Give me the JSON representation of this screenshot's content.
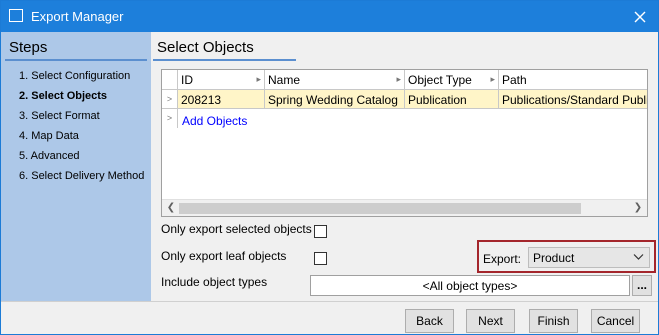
{
  "window": {
    "title": "Export Manager"
  },
  "steps": {
    "title": "Steps",
    "items": [
      {
        "label": "1. Select Configuration",
        "active": false
      },
      {
        "label": "2. Select Objects",
        "active": true
      },
      {
        "label": "3. Select Format",
        "active": false
      },
      {
        "label": "4. Map Data",
        "active": false
      },
      {
        "label": "5. Advanced",
        "active": false
      },
      {
        "label": "6. Select Delivery Method",
        "active": false
      }
    ]
  },
  "main": {
    "title": "Select Objects",
    "table": {
      "columns": [
        "ID",
        "Name",
        "Object Type",
        "Path"
      ],
      "rows": [
        [
          "208213",
          "Spring Wedding Catalog",
          "Publication",
          "Publications/Standard Public..."
        ]
      ],
      "add_link": "Add Objects"
    },
    "options": {
      "only_selected": "Only export selected objects",
      "only_leaf": "Only export leaf objects",
      "include_types": "Include object types",
      "include_types_value": "<All object types>",
      "browse_button": "..."
    },
    "export": {
      "label": "Export:",
      "value": "Product"
    }
  },
  "footer": {
    "back": "Back",
    "next": "Next",
    "finish": "Finish",
    "cancel": "Cancel"
  },
  "colors": {
    "titlebar": "#1d7fdb",
    "steps_panel": "#adc8e8",
    "selected_row": "#fff5c8",
    "highlight_border": "#a4262c",
    "link": "#0000ff"
  }
}
